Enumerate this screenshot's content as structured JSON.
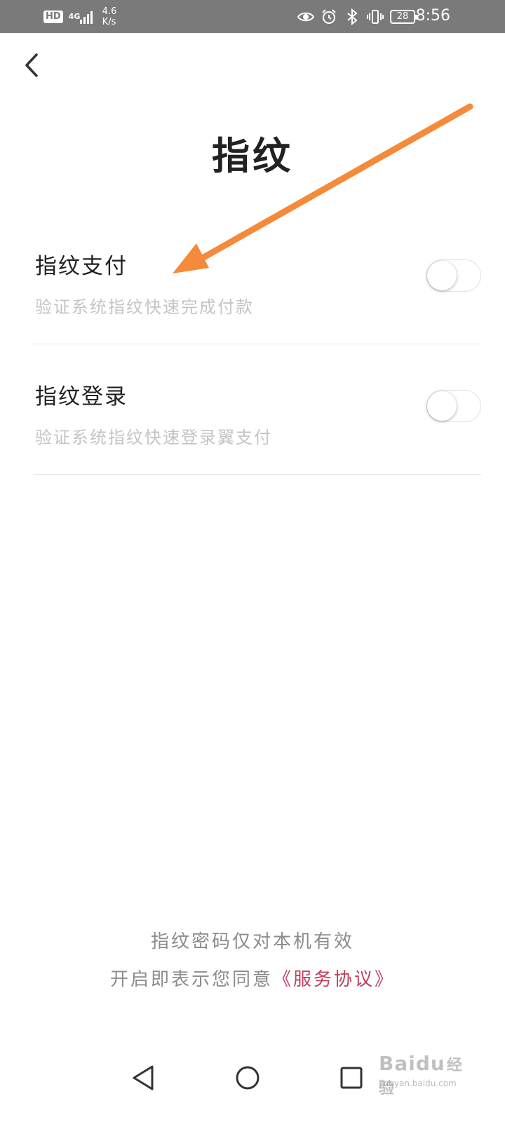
{
  "status_bar": {
    "hd_badge": "HD",
    "network": "4G",
    "net_speed_value": "4.6",
    "net_speed_unit": "K/s",
    "battery_level": "28",
    "time": "8:56",
    "icons": [
      "eye-icon",
      "alarm-icon",
      "bluetooth-icon",
      "vibrate-icon"
    ]
  },
  "header": {
    "back_icon": "chevron-left-icon",
    "title": "指纹"
  },
  "settings": [
    {
      "title": "指纹支付",
      "description": "验证系统指纹快速完成付款",
      "enabled": false
    },
    {
      "title": "指纹登录",
      "description": "验证系统指纹快速登录翼支付",
      "enabled": false
    }
  ],
  "footer": {
    "note": "指纹密码仅对本机有效",
    "agree_prefix": "开启即表示您同意",
    "agreement_link": "《服务协议》"
  },
  "annotation": {
    "arrow_color": "#f48a3a"
  },
  "watermark": {
    "brand": "Bai",
    "brand_suffix": "du",
    "brand_cn": "经验",
    "url": "jingyan.baidu.com"
  },
  "navigation": {
    "icons": [
      "nav-back-icon",
      "nav-home-icon",
      "nav-recent-icon"
    ]
  }
}
